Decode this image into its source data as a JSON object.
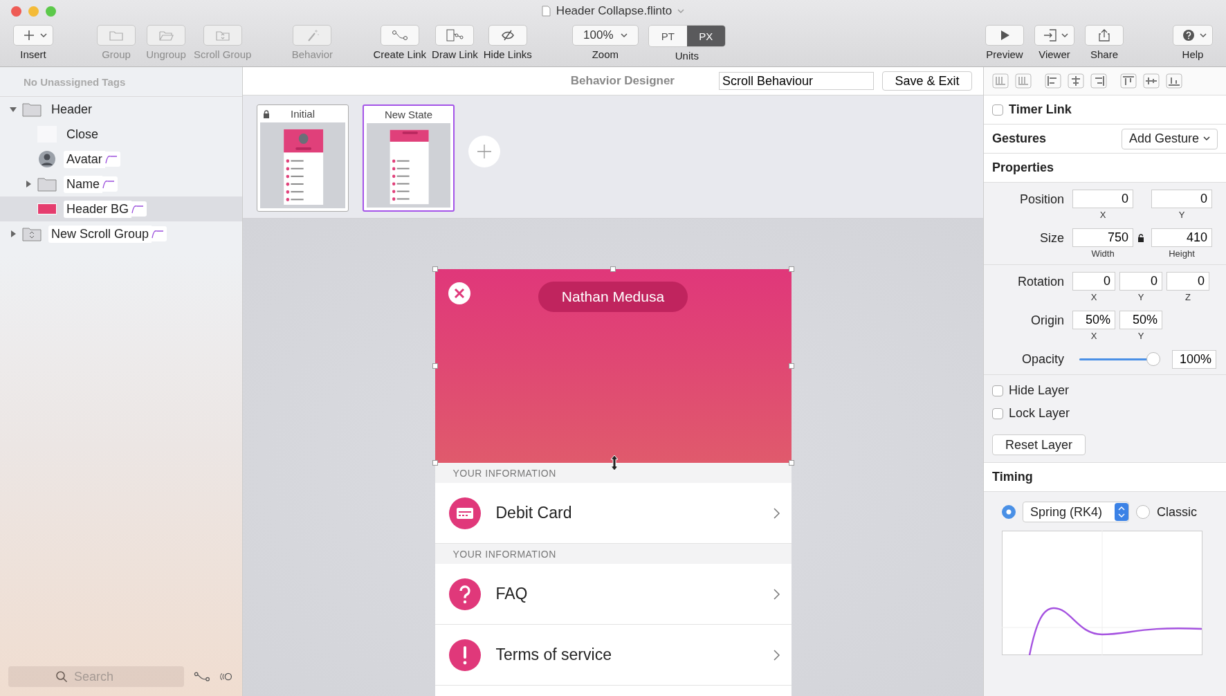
{
  "window": {
    "title": "Header Collapse.flinto"
  },
  "toolbar": {
    "left": [
      [
        {
          "label": "Insert",
          "caret": true,
          "disabled": false
        }
      ],
      [
        {
          "label": "Group",
          "caret": false,
          "disabled": true
        },
        {
          "label": "Ungroup",
          "caret": false,
          "disabled": true
        },
        {
          "label": "Scroll Group",
          "caret": false,
          "disabled": true
        }
      ],
      [
        {
          "label": "Behavior",
          "caret": false,
          "disabled": true
        }
      ],
      [
        {
          "label": "Create Link",
          "caret": false,
          "disabled": false
        },
        {
          "label": "Draw Link",
          "caret": false,
          "disabled": false
        },
        {
          "label": "Hide Links",
          "caret": false,
          "disabled": false
        }
      ]
    ],
    "zoom": {
      "label": "Zoom",
      "value": "100%"
    },
    "units": {
      "label": "Units",
      "options": [
        {
          "label": "PT",
          "selected": false
        },
        {
          "label": "PX",
          "selected": true
        }
      ]
    },
    "right": [
      [
        {
          "label": "Preview",
          "caret": false,
          "disabled": false
        },
        {
          "label": "Viewer",
          "caret": true,
          "disabled": false
        },
        {
          "label": "Share",
          "caret": false,
          "disabled": false
        }
      ],
      [
        {
          "label": "Help",
          "caret": true,
          "disabled": false
        }
      ]
    ]
  },
  "sidebar": {
    "tags": "No Unassigned Tags",
    "layers": [
      {
        "name": "Header",
        "kind": "folder",
        "expanded": true,
        "selected": false,
        "behavior": false,
        "children": [
          {
            "name": "Close",
            "kind": "blank",
            "selected": false,
            "behavior": false
          },
          {
            "name": "Avatar",
            "kind": "avatar",
            "selected": false,
            "behavior": true
          },
          {
            "name": "Name",
            "kind": "folder",
            "expanded": false,
            "selected": false,
            "behavior": true
          },
          {
            "name": "Header BG",
            "kind": "swatch",
            "selected": true,
            "behavior": true
          }
        ]
      },
      {
        "name": "New Scroll Group",
        "kind": "scroll-group",
        "expanded": false,
        "selected": false,
        "behavior": true
      }
    ],
    "search": {
      "placeholder": "Search"
    }
  },
  "designer": {
    "title": "Behavior Designer",
    "name_value": "Scroll Behaviour",
    "save_button": "Save & Exit",
    "states": [
      {
        "name": "Initial",
        "locked": true,
        "selected": false,
        "kind": "expanded"
      },
      {
        "name": "New State",
        "locked": false,
        "selected": true,
        "kind": "collapsed"
      }
    ]
  },
  "phone": {
    "header_name": "Nathan Medusa",
    "sections": [
      {
        "title": "YOUR INFORMATION",
        "rows": [
          {
            "label": "Debit Card",
            "kind": "card"
          }
        ]
      },
      {
        "title": "YOUR INFORMATION",
        "rows": [
          {
            "label": "FAQ",
            "kind": "question"
          },
          {
            "label": "Terms of service",
            "kind": "exclamation"
          }
        ]
      }
    ]
  },
  "inspector": {
    "timer_link": {
      "label": "Timer Link",
      "checked": false
    },
    "gestures": {
      "title": "Gestures",
      "button": "Add Gesture"
    },
    "properties": {
      "title": "Properties",
      "groups": [
        [
          {
            "label": "Position",
            "kind": "wide",
            "locked": false,
            "fields": [
              {
                "value": "0",
                "caption": "X"
              },
              {
                "value": "0",
                "caption": "Y"
              }
            ]
          },
          {
            "label": "Size",
            "kind": "wide",
            "locked": true,
            "fields": [
              {
                "value": "750",
                "caption": "Width"
              },
              {
                "value": "410",
                "caption": "Height"
              }
            ]
          }
        ],
        [
          {
            "label": "Rotation",
            "kind": "narrow",
            "fields": [
              {
                "value": "0",
                "caption": "X"
              },
              {
                "value": "0",
                "caption": "Y"
              },
              {
                "value": "0",
                "caption": "Z"
              }
            ]
          },
          {
            "label": "Origin",
            "kind": "narrow",
            "fields": [
              {
                "value": "50%",
                "caption": "X"
              },
              {
                "value": "50%",
                "caption": "Y"
              }
            ]
          },
          {
            "label": "Opacity",
            "kind": "slider",
            "level": 0.97,
            "reading": "100%"
          }
        ]
      ]
    },
    "layer_options": [
      {
        "label": "Hide Layer",
        "checked": false
      },
      {
        "label": "Lock Layer",
        "checked": false
      }
    ],
    "reset_button": "Reset Layer",
    "timing": {
      "title": "Timing",
      "options": [
        {
          "kind": "dropdown",
          "label": "Spring (RK4)",
          "selected": true
        },
        {
          "kind": "plain",
          "label": "Classic",
          "selected": false
        }
      ]
    }
  }
}
